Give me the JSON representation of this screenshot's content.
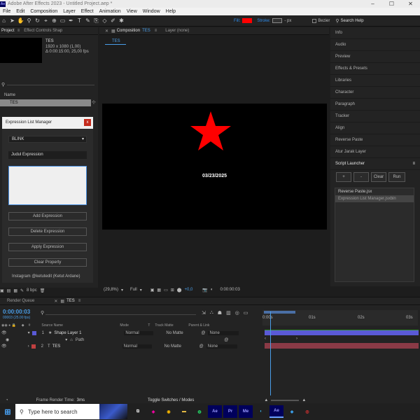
{
  "titlebar": {
    "title": "Adobe After Effects 2023 - Untitled Project.aep *",
    "logo": "Ae"
  },
  "menu": [
    "File",
    "Edit",
    "Composition",
    "Layer",
    "Effect",
    "Animation",
    "View",
    "Window",
    "Help"
  ],
  "toolbar": {
    "fill_label": "Fill:",
    "stroke_label": "Stroke:",
    "stroke_value": "- px",
    "bezier_label": "Bezier",
    "search_placeholder": "Search Help",
    "fill_color": "#ff0000"
  },
  "project": {
    "tab": "Project",
    "tab2": "Effect Controls Shap",
    "item": "TES",
    "size": "1920 x 1080 (1,00)",
    "duration": "Δ 0:00:15:00, 25,00 fps",
    "name_header": "Name",
    "row": "TES",
    "bpc": "8 bpc"
  },
  "dialog": {
    "title": "Expression List Manager",
    "close": "x",
    "dropdown": "BLINK",
    "name_field": "Judul Expression",
    "add": "Add Expression",
    "delete": "Delete Expression",
    "apply": "Apply Expression",
    "clear": "Clear Property",
    "credit": "Instagram @ketutedit (Ketut Ardane)"
  },
  "comp": {
    "tab": "Composition",
    "tab_name": "TES",
    "layer_tab": "Layer (none)",
    "subtab": "TES",
    "date": "03/23/2025",
    "zoom": "(29,8%)",
    "quality": "Full",
    "exposure": "+0,0",
    "timecode": "0:00:00:03",
    "star_color": "#ff0000"
  },
  "right": {
    "panels": [
      "Info",
      "Audio",
      "Preview",
      "Effects & Presets",
      "Libraries",
      "Character",
      "Paragraph",
      "Tracker",
      "Align",
      "Reverse Paste",
      "Atur Jarak Layer"
    ],
    "script_launcher": "Script Launcher",
    "buttons": [
      "+",
      "-",
      "Clear",
      "Run"
    ],
    "scripts": [
      "Reverse Paste.jsx",
      "Expression List Manager.jsxbin"
    ]
  },
  "timeline": {
    "tab1": "Render Queue",
    "tab2": "TES",
    "timecode": "0:00:00:03",
    "frames": "00003 (25.00 fps)",
    "col_source": "Source Name",
    "col_mode": "Mode",
    "col_t": "T",
    "col_track": "Track Matte",
    "col_parent": "Parent & Link",
    "ruler": [
      "0:00s",
      "01s",
      "02s",
      "03s"
    ],
    "layers": [
      {
        "num": "1",
        "name": "Shape Layer 1",
        "mode": "Normal",
        "track": "No Matte",
        "parent": "None",
        "color": "#5a5ad6"
      },
      {
        "num": "",
        "name": "Path",
        "mode": "",
        "track": "",
        "parent": "",
        "color": ""
      },
      {
        "num": "2",
        "name": "TES",
        "mode": "Normal",
        "track": "No Matte",
        "parent": "None",
        "color": "#c04040"
      }
    ],
    "render_time_label": "Frame Render Time:",
    "render_time": "3ms",
    "toggle": "Toggle Switches / Modes"
  },
  "taskbar": {
    "search": "Type here to search",
    "apps": [
      "Ae",
      "Pr",
      "Me",
      "Ae"
    ]
  }
}
